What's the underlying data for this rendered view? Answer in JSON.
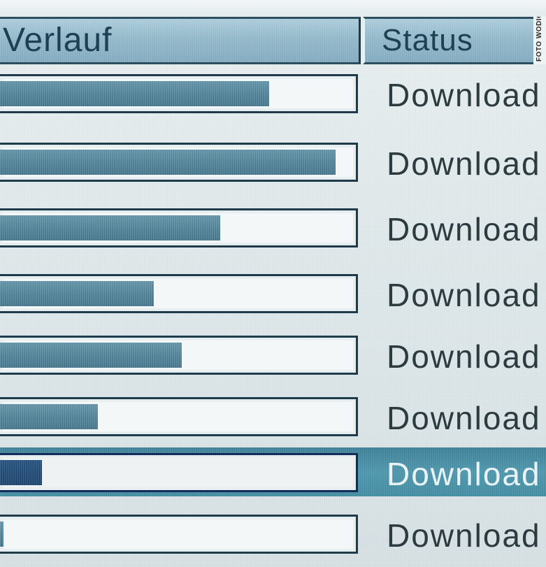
{
  "columns": {
    "progress_header": "Verlauf",
    "status_header": "Status"
  },
  "watermark": "FOTO WODICKA",
  "colors": {
    "header_bg": "#8fb6c8",
    "progress_fill": "#4a7d93",
    "selected_row_bg": "#4a93a9",
    "selected_fill": "#173f69",
    "frame_border": "#1f3a49"
  },
  "downloads": [
    {
      "progress_percent": 77,
      "status": "Download",
      "selected": false
    },
    {
      "progress_percent": 96,
      "status": "Download",
      "selected": false
    },
    {
      "progress_percent": 63,
      "status": "Download",
      "selected": false
    },
    {
      "progress_percent": 44,
      "status": "Download",
      "selected": false
    },
    {
      "progress_percent": 52,
      "status": "Download",
      "selected": false
    },
    {
      "progress_percent": 28,
      "status": "Download",
      "selected": false
    },
    {
      "progress_percent": 12,
      "status": "Download",
      "selected": true
    },
    {
      "progress_percent": 1,
      "status": "Download",
      "selected": false
    }
  ]
}
